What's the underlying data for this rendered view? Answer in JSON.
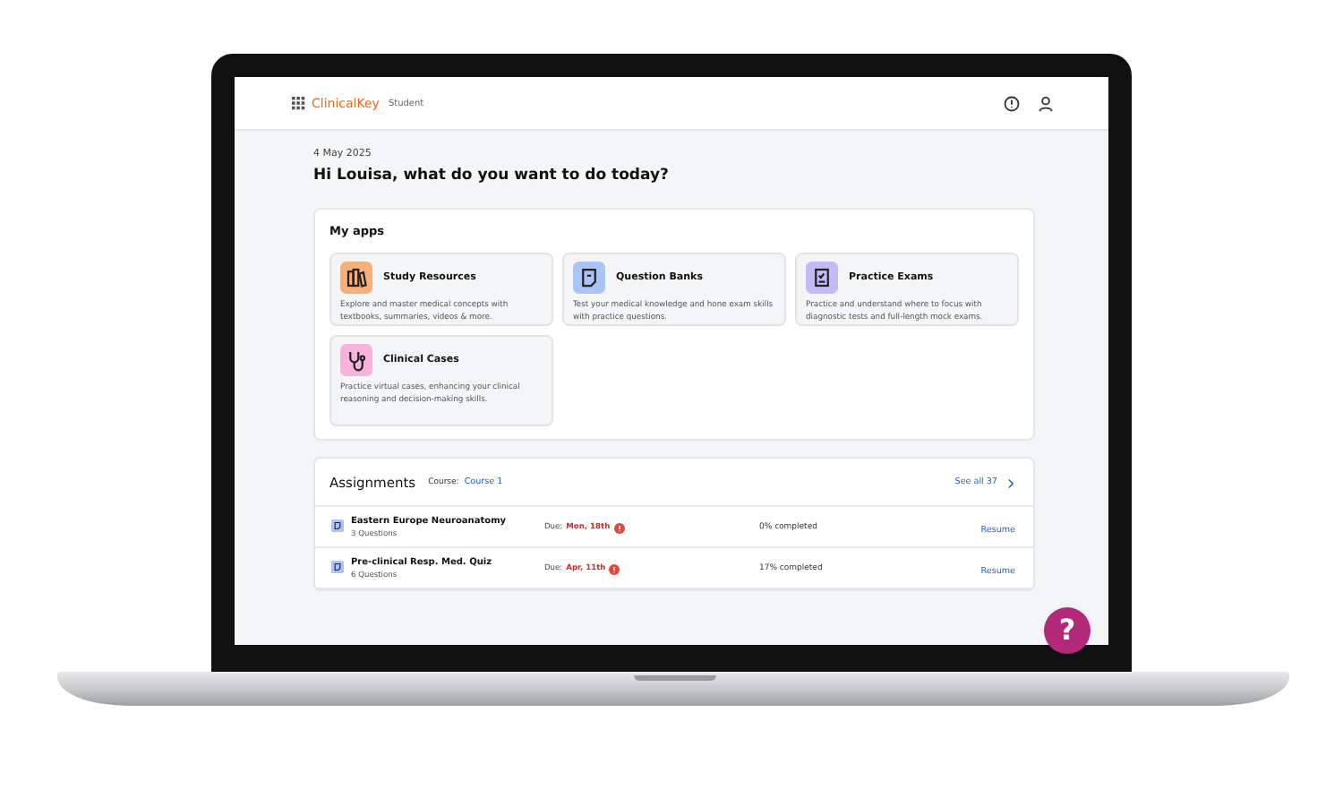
{
  "header": {
    "brand": "ClinicalKey",
    "product": "Student"
  },
  "date": "4 May 2025",
  "greeting": "Hi Louisa, what do you want to do today?",
  "apps": {
    "title": "My apps",
    "items": [
      {
        "title": "Study Resources",
        "description": "Explore and master medical concepts with textbooks, summaries, videos & more.",
        "color": "#f7b07a",
        "kind": "books"
      },
      {
        "title": "Question Banks",
        "description": "Test your medical knowledge and hone exam skills with practice questions.",
        "color": "#aac4f6",
        "kind": "bank"
      },
      {
        "title": "Practice Exams",
        "description": "Practice and understand where to focus with diagnostic tests and full-length mock exams.",
        "color": "#c4bbf6",
        "kind": "exam"
      },
      {
        "title": "Clinical Cases",
        "description": "Practice virtual cases, enhancing your clinical reasoning and decision-making skills.",
        "color": "#f6b4dc",
        "kind": "stethoscope"
      }
    ]
  },
  "assignments": {
    "title": "Assignments",
    "course_label": "Course:",
    "course": "Course 1",
    "see_all": "See all 37",
    "rows": [
      {
        "title": "Eastern Europe Neuroanatomy",
        "questions": "3 Questions",
        "due_label": "Due:",
        "due": "Mon, 18th",
        "progress": "0% completed",
        "action": "Resume"
      },
      {
        "title": "Pre-clinical Resp. Med. Quiz",
        "questions": "6 Questions",
        "due_label": "Due:",
        "due": "Apr, 11th",
        "progress": "17% completed",
        "action": "Resume"
      }
    ]
  },
  "help": "?"
}
